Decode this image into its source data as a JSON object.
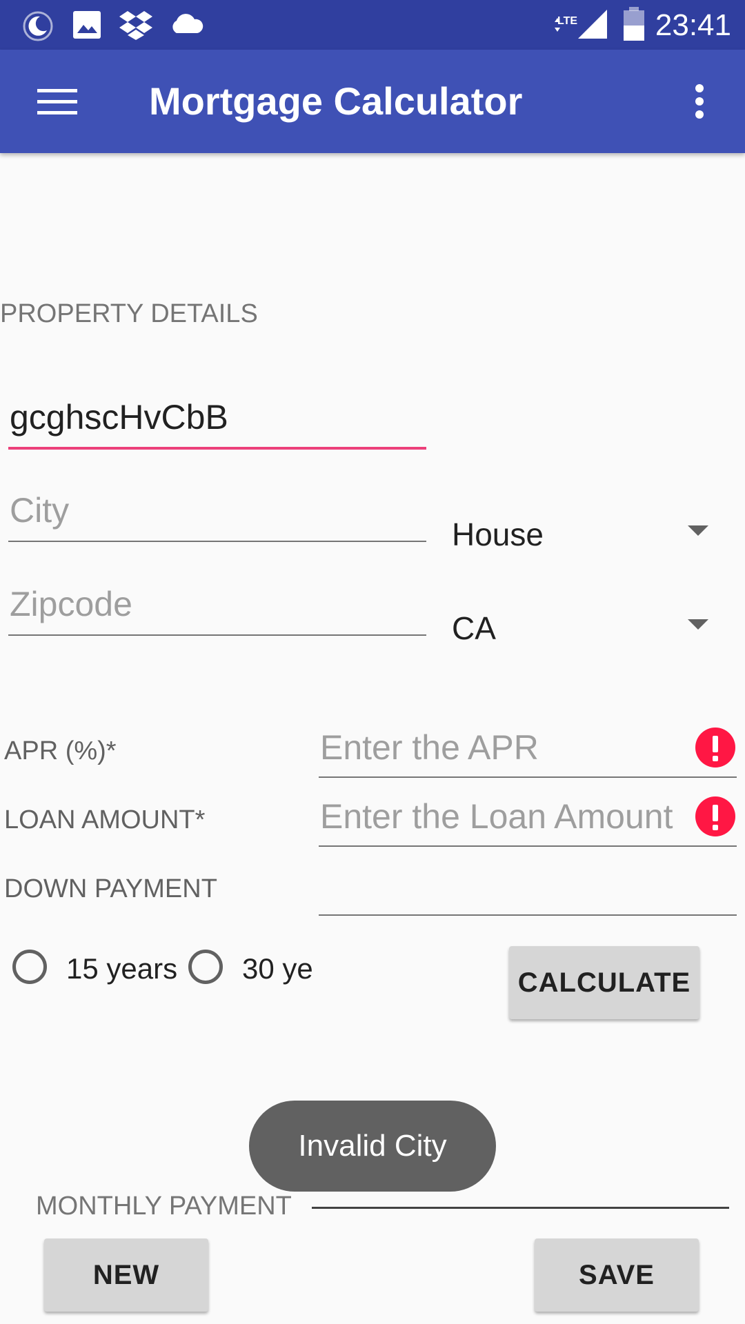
{
  "status_bar": {
    "time": "23:41",
    "network": "LTE",
    "icons": [
      "moon-icon",
      "image-icon",
      "dropbox-icon",
      "cloud-icon",
      "signal-icon",
      "battery-icon"
    ]
  },
  "app_bar": {
    "title": "Mortgage Calculator",
    "color": "#3f51b5",
    "status_color": "#303f9f"
  },
  "property": {
    "section_label": "PROPERTY DETAILS",
    "street_value": "gcghscHvCbB",
    "city_placeholder": "City",
    "zip_placeholder": "Zipcode",
    "property_type": "House",
    "state": "CA"
  },
  "loan": {
    "apr_label": "APR (%)*",
    "apr_placeholder": "Enter the APR",
    "amount_label": "LOAN AMOUNT*",
    "amount_placeholder": "Enter the Loan Amount",
    "down_label": "DOWN PAYMENT",
    "down_value": ""
  },
  "term": {
    "option1": "15 years",
    "option2": "30 ye"
  },
  "buttons": {
    "calculate": "CALCULATE",
    "new": "NEW",
    "save": "SAVE"
  },
  "toast": "Invalid City",
  "result": {
    "monthly_label": "MONTHLY PAYMENT"
  },
  "colors": {
    "accent": "#ec407a",
    "error": "#ff1744"
  }
}
